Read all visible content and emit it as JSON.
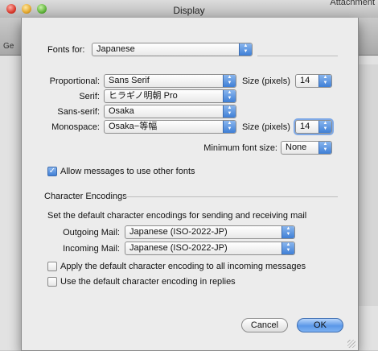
{
  "window": {
    "title": "Display"
  },
  "background": {
    "attachment_label": "Attachment",
    "left_fragment": "Ge"
  },
  "fonts": {
    "fonts_for_label": "Fonts for:",
    "fonts_for_value": "Japanese",
    "proportional_label": "Proportional:",
    "proportional_value": "Sans Serif",
    "serif_label": "Serif:",
    "serif_value": "ヒラギノ明朝 Pro",
    "sans_serif_label": "Sans-serif:",
    "sans_serif_value": "Osaka",
    "monospace_label": "Monospace:",
    "monospace_value": "Osaka−等幅",
    "size_label_1": "Size (pixels)",
    "size_value_1": "14",
    "size_label_2": "Size (pixels)",
    "size_value_2": "14",
    "min_font_size_label": "Minimum font size:",
    "min_font_size_value": "None",
    "allow_other_fonts_label": "Allow messages to use other fonts",
    "allow_other_fonts_checked": true
  },
  "encodings": {
    "section_title": "Character Encodings",
    "description": "Set the default character encodings for sending and receiving mail",
    "outgoing_label": "Outgoing Mail:",
    "outgoing_value": "Japanese (ISO-2022-JP)",
    "incoming_label": "Incoming Mail:",
    "incoming_value": "Japanese (ISO-2022-JP)",
    "apply_incoming_label": "Apply the default character encoding to all incoming messages",
    "apply_incoming_checked": false,
    "use_in_replies_label": "Use the default character encoding in replies",
    "use_in_replies_checked": false
  },
  "buttons": {
    "cancel": "Cancel",
    "ok": "OK"
  },
  "colors": {
    "accent": "#3f7fd6",
    "sheet_bg": "#ececec"
  }
}
